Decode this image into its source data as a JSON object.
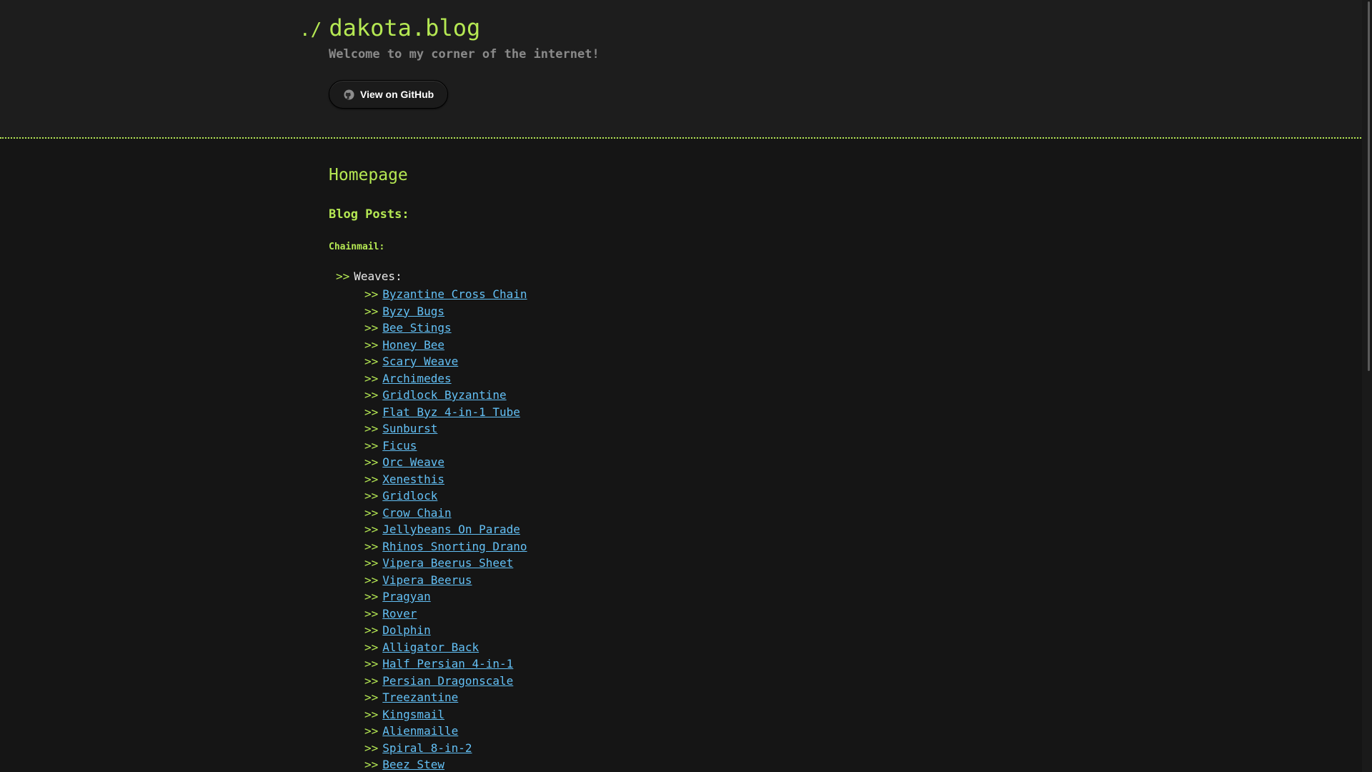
{
  "header": {
    "prompt": "./",
    "title": "dakota.blog",
    "tagline": "Welcome to my corner of the internet!",
    "github_button_label": "View on GitHub",
    "github_icon": "github-icon"
  },
  "main": {
    "page_heading": "Homepage",
    "section_heading": "Blog Posts:",
    "category_heading": "Chainmail:",
    "subgroup": {
      "arrow": ">>",
      "label": "Weaves:"
    },
    "posts": [
      {
        "arrow": ">>",
        "title": "Byzantine Cross Chain"
      },
      {
        "arrow": ">>",
        "title": "Byzy Bugs"
      },
      {
        "arrow": ">>",
        "title": "Bee Stings"
      },
      {
        "arrow": ">>",
        "title": "Honey Bee"
      },
      {
        "arrow": ">>",
        "title": "Scary Weave"
      },
      {
        "arrow": ">>",
        "title": "Archimedes"
      },
      {
        "arrow": ">>",
        "title": "Gridlock Byzantine"
      },
      {
        "arrow": ">>",
        "title": "Flat Byz 4-in-1 Tube"
      },
      {
        "arrow": ">>",
        "title": "Sunburst"
      },
      {
        "arrow": ">>",
        "title": "Ficus"
      },
      {
        "arrow": ">>",
        "title": "Orc Weave"
      },
      {
        "arrow": ">>",
        "title": "Xenesthis"
      },
      {
        "arrow": ">>",
        "title": "Gridlock"
      },
      {
        "arrow": ">>",
        "title": "Crow Chain"
      },
      {
        "arrow": ">>",
        "title": "Jellybeans On Parade"
      },
      {
        "arrow": ">>",
        "title": "Rhinos Snorting Drano"
      },
      {
        "arrow": ">>",
        "title": "Vipera Beerus Sheet"
      },
      {
        "arrow": ">>",
        "title": "Vipera Beerus"
      },
      {
        "arrow": ">>",
        "title": "Pragyan"
      },
      {
        "arrow": ">>",
        "title": "Rover"
      },
      {
        "arrow": ">>",
        "title": "Dolphin"
      },
      {
        "arrow": ">>",
        "title": "Alligator Back"
      },
      {
        "arrow": ">>",
        "title": "Half Persian 4-in-1"
      },
      {
        "arrow": ">>",
        "title": "Persian Dragonscale"
      },
      {
        "arrow": ">>",
        "title": "Treezantine"
      },
      {
        "arrow": ">>",
        "title": "Kingsmail"
      },
      {
        "arrow": ">>",
        "title": "Alienmaille"
      },
      {
        "arrow": ">>",
        "title": "Spiral 8-in-2"
      },
      {
        "arrow": ">>",
        "title": "Beez Stew"
      }
    ]
  },
  "colors": {
    "background": "#151515",
    "header_background": "#1d1d1d",
    "accent": "#b5e853",
    "link": "#63c0f5",
    "muted": "#8a8a8a"
  }
}
